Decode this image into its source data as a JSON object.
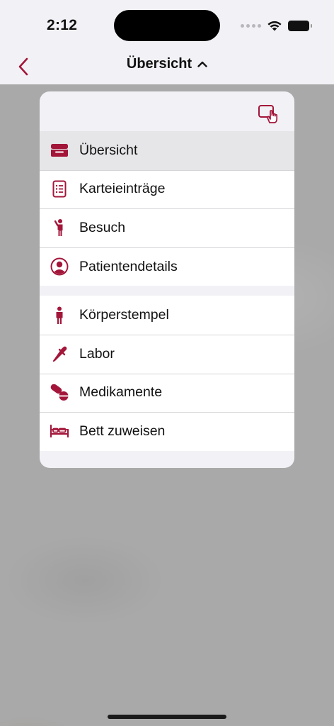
{
  "status_bar": {
    "time": "2:12"
  },
  "nav": {
    "title": "Übersicht"
  },
  "menu": {
    "groups": [
      {
        "items": [
          {
            "label": "Übersicht",
            "icon": "tray-icon",
            "selected": true
          },
          {
            "label": "Karteieinträge",
            "icon": "list-document-icon"
          },
          {
            "label": "Besuch",
            "icon": "person-wave-icon"
          },
          {
            "label": "Patientendetails",
            "icon": "person-circle-icon"
          }
        ]
      },
      {
        "items": [
          {
            "label": "Körperstempel",
            "icon": "person-standing-icon"
          },
          {
            "label": "Labor",
            "icon": "dropper-icon"
          },
          {
            "label": "Medikamente",
            "icon": "pills-icon"
          },
          {
            "label": "Bett zuweisen",
            "icon": "bed-icon"
          }
        ]
      }
    ]
  },
  "colors": {
    "accent": "#A3163A",
    "background": "#F2F2F6",
    "dim": "#A9A9A9"
  }
}
